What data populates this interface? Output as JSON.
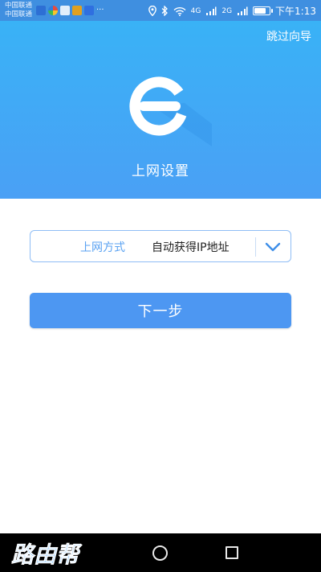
{
  "status_bar": {
    "carrier_line1": "中国联通",
    "carrier_line2": "中国联通",
    "more_notifications": "···",
    "signal_1_label": "4G",
    "signal_2_label": "2G",
    "battery_percent": 80,
    "time": "下午1:13"
  },
  "header": {
    "skip_label": "跳过向导",
    "title": "上网设置"
  },
  "form": {
    "method_label": "上网方式",
    "method_value": "自动获得IP地址"
  },
  "actions": {
    "next_label": "下一步"
  },
  "watermark": {
    "text": "路由帮"
  },
  "colors": {
    "header_top": "#39b2f6",
    "header_bottom": "#4aa0f5",
    "primary_button": "#4d97f2",
    "accent_text": "#5aa2f2",
    "select_border": "#8fbdf5"
  },
  "icons": {
    "logo": "e-logo-icon",
    "dropdown": "chevron-down-icon",
    "home": "home-circle-icon",
    "recents": "recents-square-icon"
  }
}
